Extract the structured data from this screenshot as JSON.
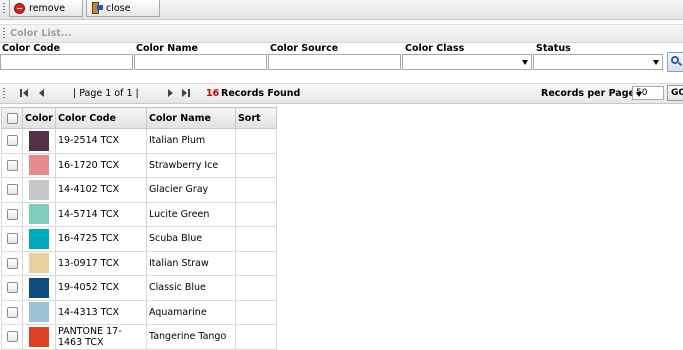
{
  "toolbar": {
    "remove_label": "remove",
    "close_label": "close"
  },
  "section": {
    "title": "Color List..."
  },
  "filters": {
    "color_code": {
      "label": "Color Code",
      "value": ""
    },
    "color_name": {
      "label": "Color Name",
      "value": ""
    },
    "color_source": {
      "label": "Color Source",
      "value": ""
    },
    "color_class": {
      "label": "Color Class",
      "value": ""
    },
    "status": {
      "label": "Status",
      "value": ""
    }
  },
  "pager": {
    "page_text": "| Page 1 of 1 |",
    "records_count": "16",
    "records_text": "Records Found",
    "rpp_label": "Records per Page:",
    "rpp_value": "50",
    "go_label": "GO"
  },
  "grid": {
    "headers": {
      "color": "Color",
      "code": "Color Code",
      "name": "Color Name",
      "sort": "Sort"
    },
    "rows": [
      {
        "code": "19-2514 TCX",
        "name": "Italian Plum",
        "hex": "#533146"
      },
      {
        "code": "16-1720 TCX",
        "name": "Strawberry Ice",
        "hex": "#e78b90"
      },
      {
        "code": "14-4102 TCX",
        "name": "Glacier Gray",
        "hex": "#c5c6c7"
      },
      {
        "code": "14-5714 TCX",
        "name": "Lucite Green",
        "hex": "#7ecdbb"
      },
      {
        "code": "16-4725 TCX",
        "name": "Scuba Blue",
        "hex": "#00abc0"
      },
      {
        "code": "13-0917 TCX",
        "name": "Italian Straw",
        "hex": "#e7d1a1"
      },
      {
        "code": "19-4052 TCX",
        "name": "Classic Blue",
        "hex": "#0f4c81"
      },
      {
        "code": "14-4313 TCX",
        "name": "Aquamarine",
        "hex": "#9dc3d4"
      },
      {
        "code": "PANTONE 17-1463 TCX",
        "name": "Tangerine Tango",
        "hex": "#dd4124"
      }
    ]
  },
  "colors": {
    "records_count_color": "#cc0000",
    "section_title_color": "#a0a0a0"
  }
}
